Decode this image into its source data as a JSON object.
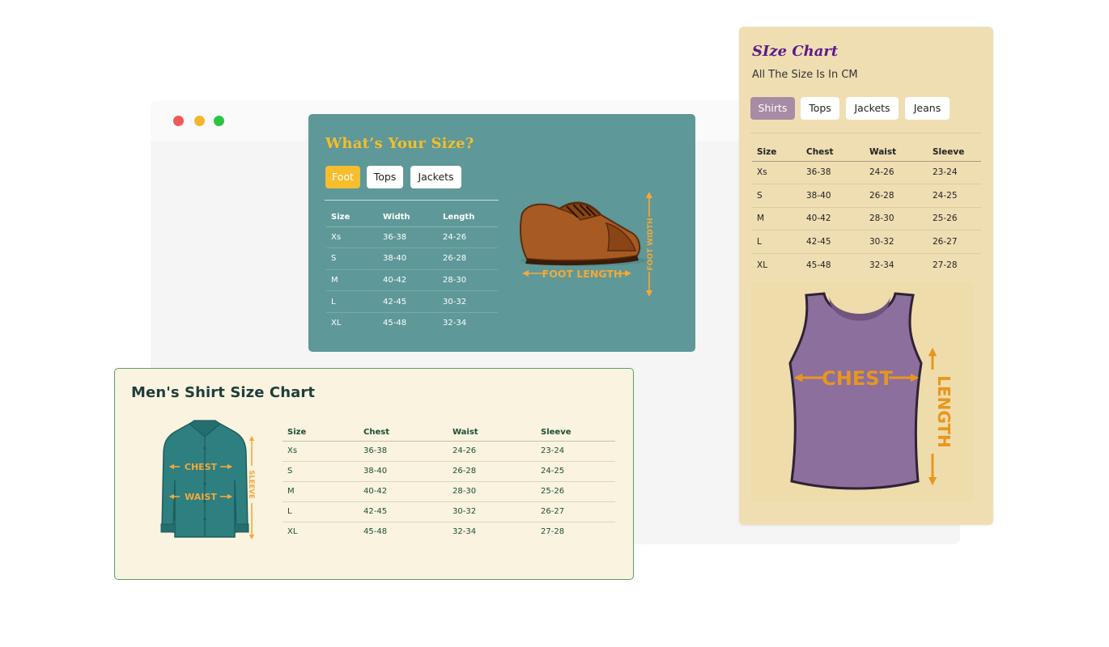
{
  "window": {
    "controls": [
      "close",
      "minimize",
      "maximize"
    ],
    "colors": {
      "close": "#ef5a58",
      "minimize": "#f5b62b",
      "maximize": "#2bc642"
    }
  },
  "foot_card": {
    "title": "What’s Your Size?",
    "tabs": [
      "Foot",
      "Tops",
      "Jackets"
    ],
    "active_tab": "Foot",
    "table": {
      "headers": [
        "Size",
        "Width",
        "Length"
      ],
      "rows": [
        [
          "Xs",
          "36-38",
          "24-26"
        ],
        [
          "S",
          "38-40",
          "26-28"
        ],
        [
          "M",
          "40-42",
          "28-30"
        ],
        [
          "L",
          "42-45",
          "30-32"
        ],
        [
          "XL",
          "45-48",
          "32-34"
        ]
      ]
    },
    "illustration": {
      "icon": "shoe-icon",
      "length_label": "FOOT LENGTH",
      "width_label": "FOOT WIDTH"
    },
    "colors": {
      "background": "#5f9898",
      "accent": "#f6bd2c"
    }
  },
  "shirt_card": {
    "title": "Men's Shirt Size Chart",
    "table": {
      "headers": [
        "Size",
        "Chest",
        "Waist",
        "Sleeve"
      ],
      "rows": [
        [
          "Xs",
          "36-38",
          "24-26",
          "23-24"
        ],
        [
          "S",
          "38-40",
          "26-28",
          "24-25"
        ],
        [
          "M",
          "40-42",
          "28-30",
          "25-26"
        ],
        [
          "L",
          "42-45",
          "30-32",
          "26-27"
        ],
        [
          "XL",
          "45-48",
          "32-34",
          "27-28"
        ]
      ]
    },
    "illustration": {
      "icon": "shirt-icon",
      "chest_label": "CHEST",
      "waist_label": "WAIST",
      "sleeve_label": "SLEEVE"
    },
    "colors": {
      "background": "#f9f3e0",
      "border": "#5e9f6a",
      "shirt": "#2e7f80",
      "arrow": "#f2a93b"
    }
  },
  "size_card": {
    "title": "SIze Chart",
    "subtitle": "All The Size Is In CM",
    "tabs": [
      "Shirts",
      "Tops",
      "Jackets",
      "Jeans"
    ],
    "active_tab": "Shirts",
    "table": {
      "headers": [
        "Size",
        "Chest",
        "Waist",
        "Sleeve"
      ],
      "rows": [
        [
          "Xs",
          "36-38",
          "24-26",
          "23-24"
        ],
        [
          "S",
          "38-40",
          "26-28",
          "24-25"
        ],
        [
          "M",
          "40-42",
          "28-30",
          "25-26"
        ],
        [
          "L",
          "42-45",
          "30-32",
          "26-27"
        ],
        [
          "XL",
          "45-48",
          "32-34",
          "27-28"
        ]
      ]
    },
    "illustration": {
      "icon": "tank-top-icon",
      "chest_label": "CHEST",
      "length_label": "LENGTH"
    },
    "colors": {
      "background": "#f0deb3",
      "title": "#5c1a8a",
      "active_tab": "#a88ba4",
      "garment": "#8c6f9c",
      "arrow": "#e8961e"
    }
  }
}
